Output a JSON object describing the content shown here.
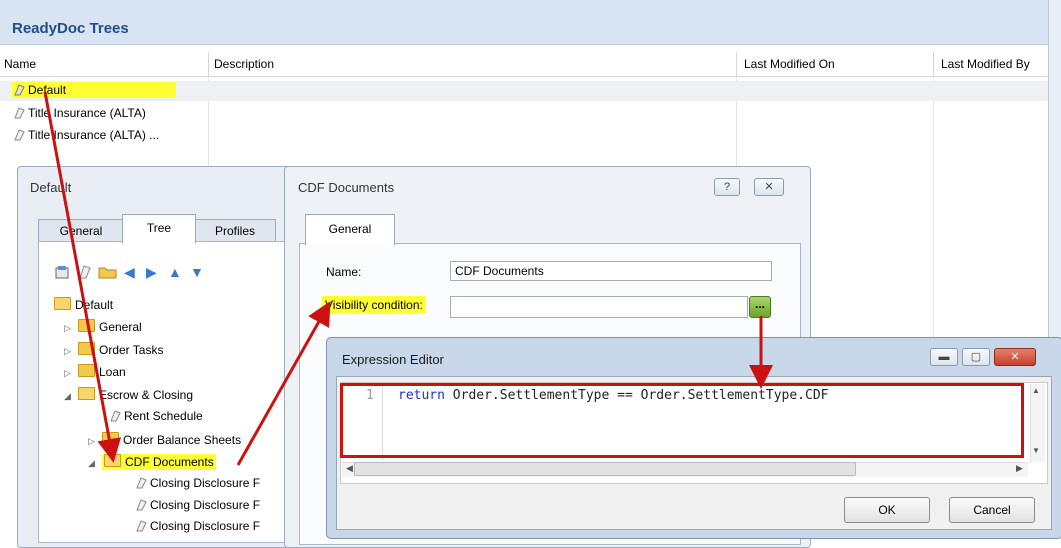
{
  "main": {
    "title": "ReadyDoc Trees",
    "columns": [
      "Name",
      "Description",
      "Last Modified On",
      "Last Modified By"
    ],
    "rows": [
      {
        "name": "Default"
      },
      {
        "name": "Title Insurance (ALTA)"
      },
      {
        "name": "Title Insurance (ALTA) ..."
      }
    ]
  },
  "default_window": {
    "title": "Default",
    "tabs": [
      "General",
      "Tree",
      "Profiles"
    ],
    "tree": {
      "root": "Default",
      "items": [
        "General",
        "Order Tasks",
        "Loan",
        "Escrow & Closing",
        "Rent Schedule",
        "Order Balance Sheets",
        "CDF Documents",
        "Closing Disclosure F",
        "Closing Disclosure F",
        "Closing Disclosure F"
      ]
    }
  },
  "cdf_dialog": {
    "title": "CDF Documents",
    "help_btn": "?",
    "close_btn": "✕",
    "tab": "General",
    "name_label": "Name:",
    "name_value": "CDF Documents",
    "visibility_label": "Visibility condition:",
    "ellipsis_btn": "..."
  },
  "expression_editor": {
    "title": "Expression Editor",
    "line_number": "1",
    "code_keyword": "return",
    "code_rest": " Order.SettlementType == Order.SettlementType.CDF",
    "ok": "OK",
    "cancel": "Cancel"
  },
  "colors": {
    "highlight": "#ffff33",
    "annotation": "#cc1111",
    "title_blue": "#1f4e8c"
  }
}
